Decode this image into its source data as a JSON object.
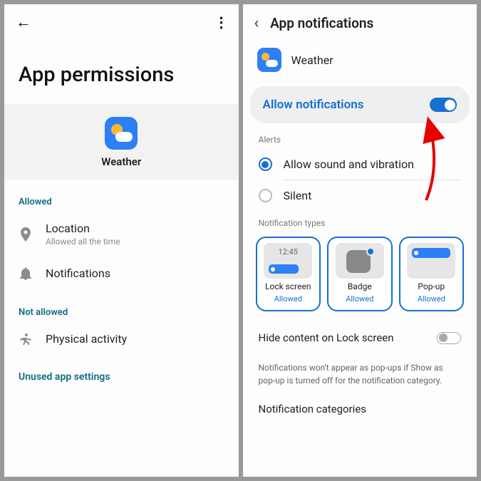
{
  "left": {
    "title": "App permissions",
    "app_name": "Weather",
    "sections": {
      "allowed": "Allowed",
      "not_allowed": "Not allowed"
    },
    "permissions": {
      "location": {
        "title": "Location",
        "sub": "Allowed all the time"
      },
      "notifications": {
        "title": "Notifications"
      },
      "physical": {
        "title": "Physical activity"
      }
    },
    "unused": "Unused app settings"
  },
  "right": {
    "title": "App notifications",
    "app_name": "Weather",
    "allow": "Allow notifications",
    "alerts_label": "Alerts",
    "alerts": {
      "sound": "Allow sound and vibration",
      "silent": "Silent"
    },
    "types_label": "Notification types",
    "types": {
      "lock": {
        "title": "Lock screen",
        "status": "Allowed",
        "time": "12:45"
      },
      "badge": {
        "title": "Badge",
        "status": "Allowed"
      },
      "popup": {
        "title": "Pop-up",
        "status": "Allowed"
      }
    },
    "hide": "Hide content on Lock screen",
    "note": "Notifications won't appear as pop-ups if Show as pop-up is turned off for the notification category.",
    "categories": "Notification categories"
  }
}
